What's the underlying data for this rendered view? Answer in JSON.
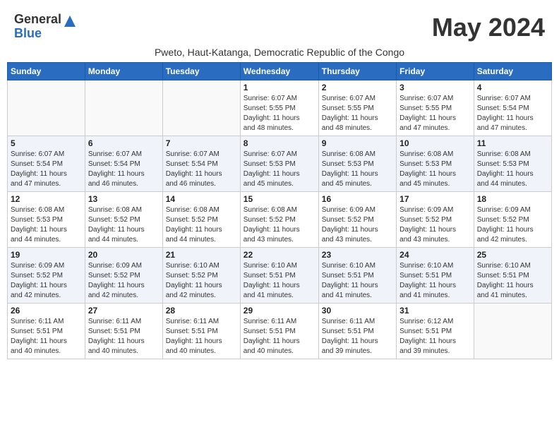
{
  "header": {
    "logo_general": "General",
    "logo_blue": "Blue",
    "month_year": "May 2024",
    "subtitle": "Pweto, Haut-Katanga, Democratic Republic of the Congo"
  },
  "days_of_week": [
    "Sunday",
    "Monday",
    "Tuesday",
    "Wednesday",
    "Thursday",
    "Friday",
    "Saturday"
  ],
  "weeks": [
    [
      {
        "day": "",
        "info": ""
      },
      {
        "day": "",
        "info": ""
      },
      {
        "day": "",
        "info": ""
      },
      {
        "day": "1",
        "info": "Sunrise: 6:07 AM\nSunset: 5:55 PM\nDaylight: 11 hours\nand 48 minutes."
      },
      {
        "day": "2",
        "info": "Sunrise: 6:07 AM\nSunset: 5:55 PM\nDaylight: 11 hours\nand 48 minutes."
      },
      {
        "day": "3",
        "info": "Sunrise: 6:07 AM\nSunset: 5:55 PM\nDaylight: 11 hours\nand 47 minutes."
      },
      {
        "day": "4",
        "info": "Sunrise: 6:07 AM\nSunset: 5:54 PM\nDaylight: 11 hours\nand 47 minutes."
      }
    ],
    [
      {
        "day": "5",
        "info": "Sunrise: 6:07 AM\nSunset: 5:54 PM\nDaylight: 11 hours\nand 47 minutes."
      },
      {
        "day": "6",
        "info": "Sunrise: 6:07 AM\nSunset: 5:54 PM\nDaylight: 11 hours\nand 46 minutes."
      },
      {
        "day": "7",
        "info": "Sunrise: 6:07 AM\nSunset: 5:54 PM\nDaylight: 11 hours\nand 46 minutes."
      },
      {
        "day": "8",
        "info": "Sunrise: 6:07 AM\nSunset: 5:53 PM\nDaylight: 11 hours\nand 45 minutes."
      },
      {
        "day": "9",
        "info": "Sunrise: 6:08 AM\nSunset: 5:53 PM\nDaylight: 11 hours\nand 45 minutes."
      },
      {
        "day": "10",
        "info": "Sunrise: 6:08 AM\nSunset: 5:53 PM\nDaylight: 11 hours\nand 45 minutes."
      },
      {
        "day": "11",
        "info": "Sunrise: 6:08 AM\nSunset: 5:53 PM\nDaylight: 11 hours\nand 44 minutes."
      }
    ],
    [
      {
        "day": "12",
        "info": "Sunrise: 6:08 AM\nSunset: 5:53 PM\nDaylight: 11 hours\nand 44 minutes."
      },
      {
        "day": "13",
        "info": "Sunrise: 6:08 AM\nSunset: 5:52 PM\nDaylight: 11 hours\nand 44 minutes."
      },
      {
        "day": "14",
        "info": "Sunrise: 6:08 AM\nSunset: 5:52 PM\nDaylight: 11 hours\nand 44 minutes."
      },
      {
        "day": "15",
        "info": "Sunrise: 6:08 AM\nSunset: 5:52 PM\nDaylight: 11 hours\nand 43 minutes."
      },
      {
        "day": "16",
        "info": "Sunrise: 6:09 AM\nSunset: 5:52 PM\nDaylight: 11 hours\nand 43 minutes."
      },
      {
        "day": "17",
        "info": "Sunrise: 6:09 AM\nSunset: 5:52 PM\nDaylight: 11 hours\nand 43 minutes."
      },
      {
        "day": "18",
        "info": "Sunrise: 6:09 AM\nSunset: 5:52 PM\nDaylight: 11 hours\nand 42 minutes."
      }
    ],
    [
      {
        "day": "19",
        "info": "Sunrise: 6:09 AM\nSunset: 5:52 PM\nDaylight: 11 hours\nand 42 minutes."
      },
      {
        "day": "20",
        "info": "Sunrise: 6:09 AM\nSunset: 5:52 PM\nDaylight: 11 hours\nand 42 minutes."
      },
      {
        "day": "21",
        "info": "Sunrise: 6:10 AM\nSunset: 5:52 PM\nDaylight: 11 hours\nand 42 minutes."
      },
      {
        "day": "22",
        "info": "Sunrise: 6:10 AM\nSunset: 5:51 PM\nDaylight: 11 hours\nand 41 minutes."
      },
      {
        "day": "23",
        "info": "Sunrise: 6:10 AM\nSunset: 5:51 PM\nDaylight: 11 hours\nand 41 minutes."
      },
      {
        "day": "24",
        "info": "Sunrise: 6:10 AM\nSunset: 5:51 PM\nDaylight: 11 hours\nand 41 minutes."
      },
      {
        "day": "25",
        "info": "Sunrise: 6:10 AM\nSunset: 5:51 PM\nDaylight: 11 hours\nand 41 minutes."
      }
    ],
    [
      {
        "day": "26",
        "info": "Sunrise: 6:11 AM\nSunset: 5:51 PM\nDaylight: 11 hours\nand 40 minutes."
      },
      {
        "day": "27",
        "info": "Sunrise: 6:11 AM\nSunset: 5:51 PM\nDaylight: 11 hours\nand 40 minutes."
      },
      {
        "day": "28",
        "info": "Sunrise: 6:11 AM\nSunset: 5:51 PM\nDaylight: 11 hours\nand 40 minutes."
      },
      {
        "day": "29",
        "info": "Sunrise: 6:11 AM\nSunset: 5:51 PM\nDaylight: 11 hours\nand 40 minutes."
      },
      {
        "day": "30",
        "info": "Sunrise: 6:11 AM\nSunset: 5:51 PM\nDaylight: 11 hours\nand 39 minutes."
      },
      {
        "day": "31",
        "info": "Sunrise: 6:12 AM\nSunset: 5:51 PM\nDaylight: 11 hours\nand 39 minutes."
      },
      {
        "day": "",
        "info": ""
      }
    ]
  ]
}
